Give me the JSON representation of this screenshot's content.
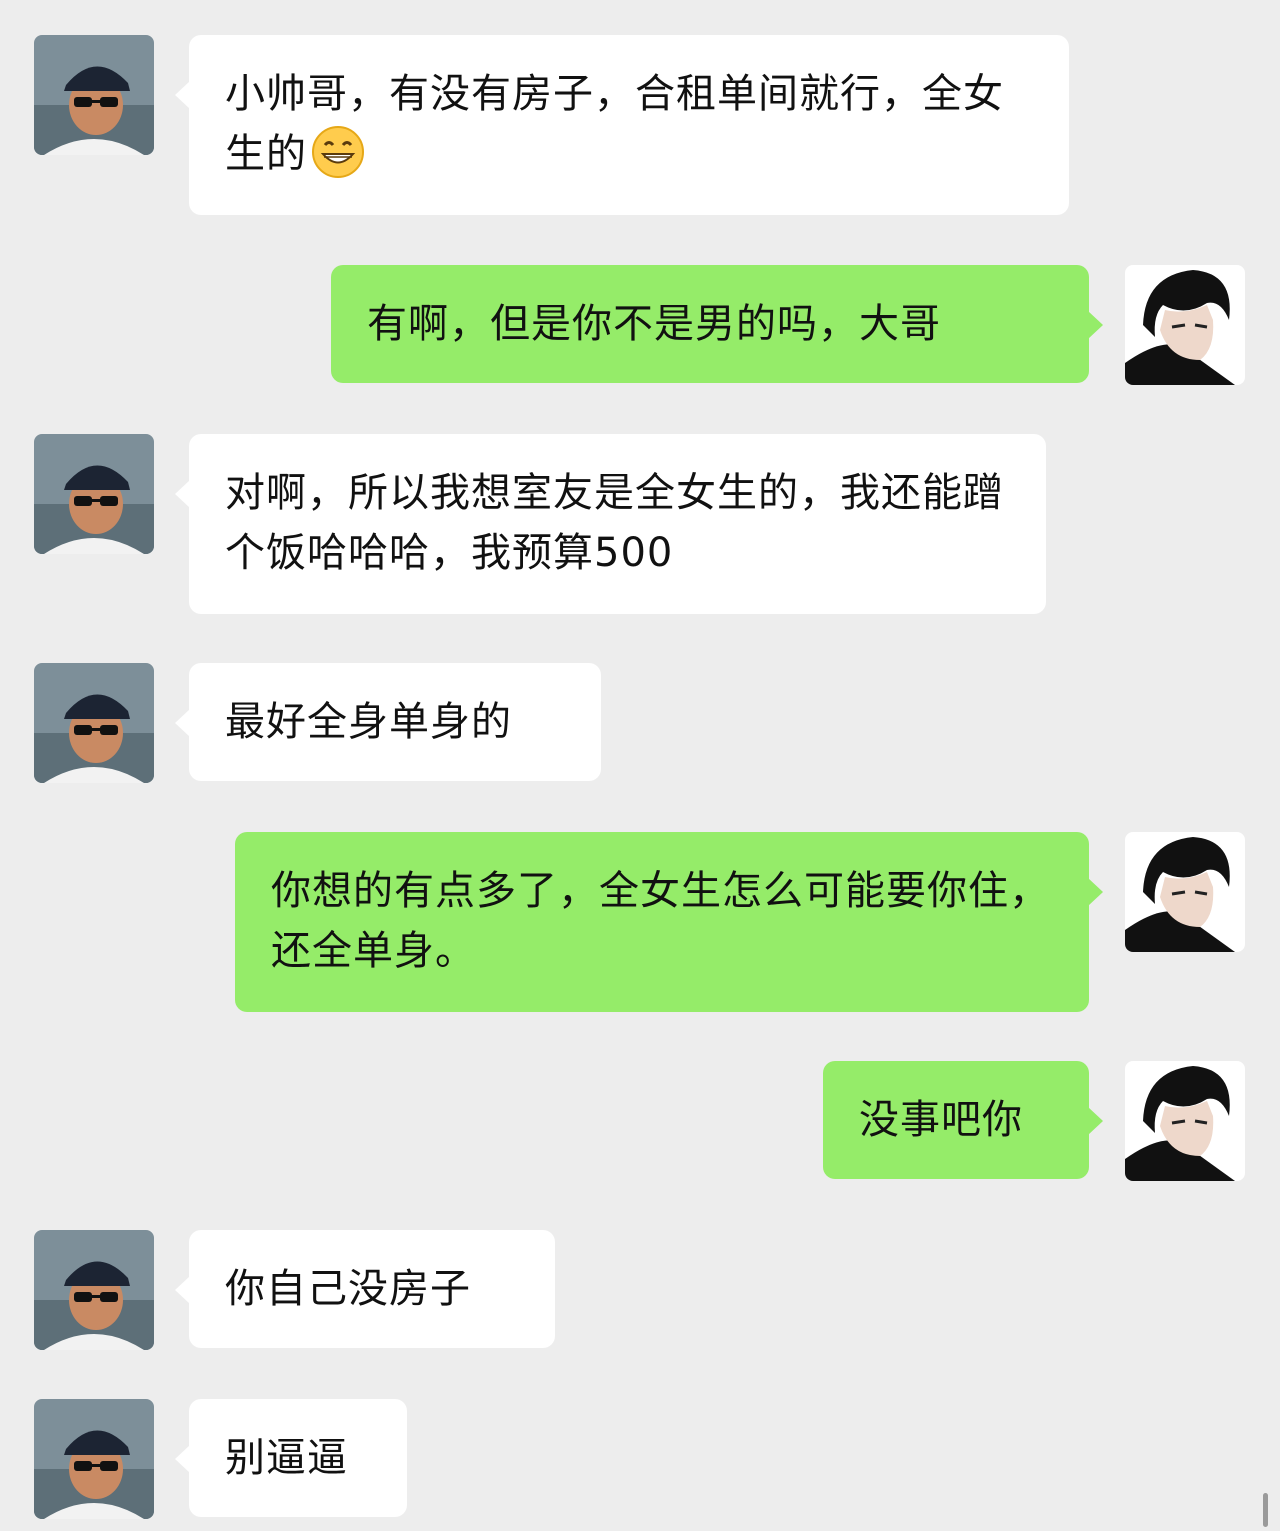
{
  "contacts": {
    "other": {
      "avatar": "man-in-cap-sunglasses-avatar"
    },
    "self": {
      "avatar": "dark-haired-person-avatar"
    }
  },
  "colors": {
    "background": "#ededed",
    "incoming_bubble": "#ffffff",
    "outgoing_bubble": "#95ec69"
  },
  "messages": [
    {
      "from": "other",
      "text": "小帅哥，有没有房子，合租单间就行，全女生的",
      "emoji": "grinning-face-emoji"
    },
    {
      "from": "self",
      "text": "有啊，但是你不是男的吗，大哥"
    },
    {
      "from": "other",
      "text": "对啊，所以我想室友是全女生的，我还能蹭个饭哈哈哈，我预算500"
    },
    {
      "from": "other",
      "text": "最好全身单身的"
    },
    {
      "from": "self",
      "text": "你想的有点多了，全女生怎么可能要你住，还全单身。"
    },
    {
      "from": "self",
      "text": "没事吧你"
    },
    {
      "from": "other",
      "text": "你自己没房子"
    },
    {
      "from": "other",
      "text": "别逼逼"
    }
  ]
}
